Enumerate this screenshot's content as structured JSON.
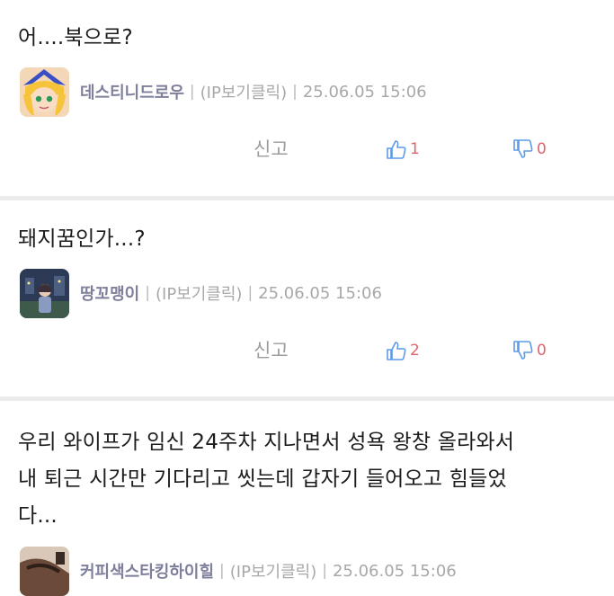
{
  "comments": [
    {
      "text": "어....북으로?",
      "author": "데스티니드로우",
      "ip": "(IP보기클릭)",
      "date": "25.06.05 15:06",
      "report": "신고",
      "likes": "1",
      "dislikes": "0",
      "avatar": "anime-girl-avatar"
    },
    {
      "text": "돼지꿈인가...?",
      "author": "땅꼬맹이",
      "ip": "(IP보기클릭)",
      "date": "25.06.05 15:06",
      "report": "신고",
      "likes": "2",
      "dislikes": "0",
      "avatar": "night-scene-avatar"
    },
    {
      "text_lines": [
        "우리 와이프가 임신 24주차 지나면서 성욕 왕창 올라와서",
        "내 퇴근 시간만 기다리고 씻는데 갑자기 들어오고 힘들었",
        "다..."
      ],
      "author": "커피색스타킹하이힐",
      "ip": "(IP보기클릭)",
      "date": "25.06.05 15:06",
      "avatar": "stocking-avatar"
    }
  ],
  "separator": "|",
  "colors": {
    "author": "#7d7f9b",
    "like_icon": "#5b9be8",
    "count": "#e0656b",
    "divider": "#ebebeb"
  },
  "icons": {
    "like": "thumbs-up-icon",
    "dislike": "thumbs-down-icon"
  }
}
